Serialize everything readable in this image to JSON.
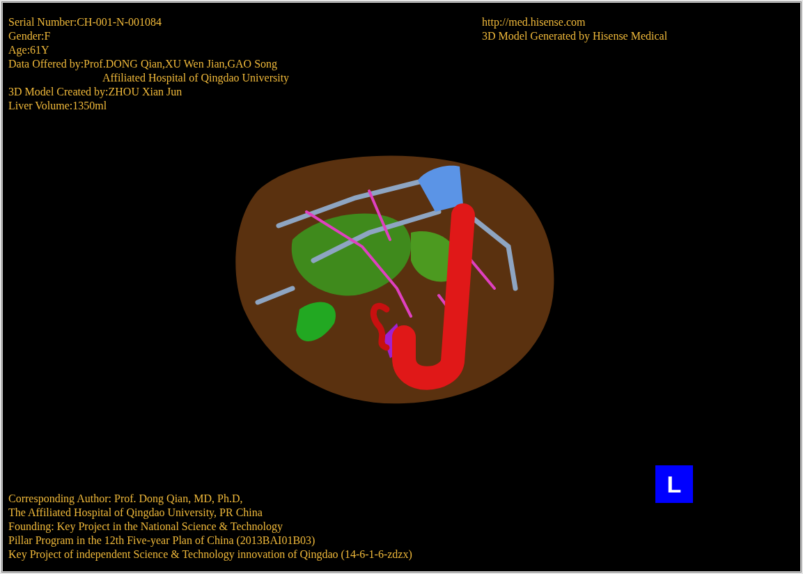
{
  "viewer": {
    "header_left": [
      {
        "text": "Serial Number:CH-001-N-001084"
      },
      {
        "text": "Gender:F"
      },
      {
        "text": "Age:61Y"
      },
      {
        "text": "Data Offered by:Prof.DONG Qian,XU Wen Jian,GAO Song",
        "continuation": "Affiliated Hospital of Qingdao University"
      },
      {
        "text": "3D Model Created by:ZHOU Xian Jun"
      },
      {
        "text": "Liver Volume:1350ml"
      }
    ],
    "header_right": [
      "http://med.hisense.com",
      "3D Model Generated by Hisense Medical"
    ],
    "orientation_badge": {
      "label": "L"
    },
    "footer": [
      "Corresponding Author: Prof. Dong Qian, MD, Ph.D,",
      "The Affiliated Hospital of Qingdao University, PR China",
      "Founding: Key Project in the National Science & Technology",
      "Pillar Program in the 12th Five-year Plan of China (2013BAI01B03)",
      "Key Project of independent Science & Technology innovation of Qingdao (14-6-1-6-zdzx)"
    ]
  }
}
